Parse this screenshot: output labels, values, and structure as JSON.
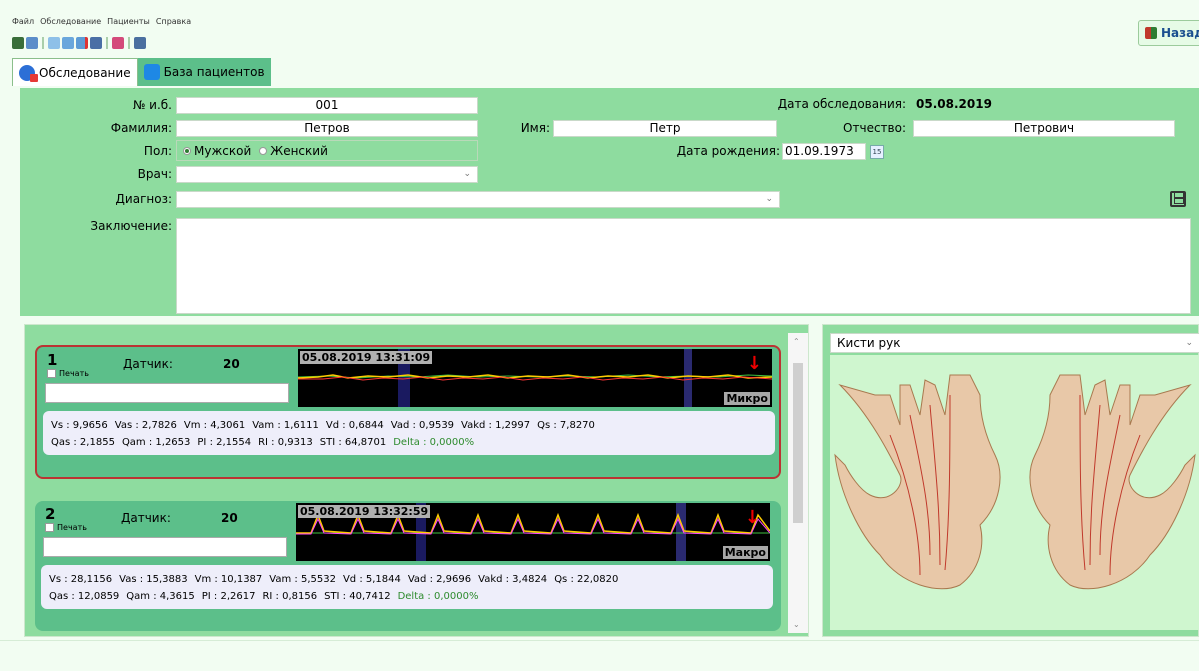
{
  "menu": [
    "Файл",
    "Обследование",
    "Пациенты",
    "Справка"
  ],
  "back_button": "Назад",
  "tabs": [
    {
      "label": "Обследование",
      "active": true
    },
    {
      "label": "База пациентов",
      "active": false
    }
  ],
  "form": {
    "record_no_label": "№ и.б.",
    "record_no": "001",
    "exam_date_label": "Дата обследования:",
    "exam_date": "05.08.2019",
    "surname_label": "Фамилия:",
    "surname": "Петров",
    "name_label": "Имя:",
    "name": "Петр",
    "patronymic_label": "Отчество:",
    "patronymic": "Петрович",
    "sex_label": "Пол:",
    "sex_options": [
      "Мужской",
      "Женский"
    ],
    "sex_selected": "Мужской",
    "birth_label": "Дата рождения:",
    "birth_date": "01.09.1973",
    "doctor_label": "Врач:",
    "doctor": "",
    "diagnosis_label": "Диагноз:",
    "diagnosis": "",
    "conclusion_label": "Заключение:",
    "conclusion": ""
  },
  "records": [
    {
      "num": "1",
      "print_label": "Печать",
      "sensor_label": "Датчик:",
      "sensor": "20",
      "timestamp": "05.08.2019 13:31:09",
      "mode": "Микро",
      "metrics_row1": [
        "Vs : 9,9656",
        "Vas : 2,7826",
        "Vm : 4,3061",
        "Vam : 1,6111",
        "Vd : 0,6844",
        "Vad : 0,9539",
        "Vakd : 1,2997",
        "Qs : 7,8270"
      ],
      "metrics_row2": [
        "Qas : 2,1855",
        "Qam : 1,2653",
        "PI : 2,1554",
        "RI : 0,9313",
        "STI : 64,8701"
      ],
      "delta": "Delta : 0,0000%"
    },
    {
      "num": "2",
      "print_label": "Печать",
      "sensor_label": "Датчик:",
      "sensor": "20",
      "timestamp": "05.08.2019 13:32:59",
      "mode": "Макро",
      "metrics_row1": [
        "Vs : 28,1156",
        "Vas : 15,3883",
        "Vm : 10,1387",
        "Vam : 5,5532",
        "Vd : 5,1844",
        "Vad : 2,9696",
        "Vakd : 3,4824",
        "Qs : 22,0820"
      ],
      "metrics_row2": [
        "Qas : 12,0859",
        "Qam : 4,3615",
        "PI : 2,2617",
        "RI : 0,8156",
        "STI : 40,7412"
      ],
      "delta": "Delta : 0,0000%"
    }
  ],
  "hands": {
    "selected": "Кисти рук"
  },
  "colors": {
    "panel": "#8edc9f",
    "record_bg": "#5cbf8a",
    "selected_border": "#b33333",
    "delta": "#2e8b2e"
  }
}
